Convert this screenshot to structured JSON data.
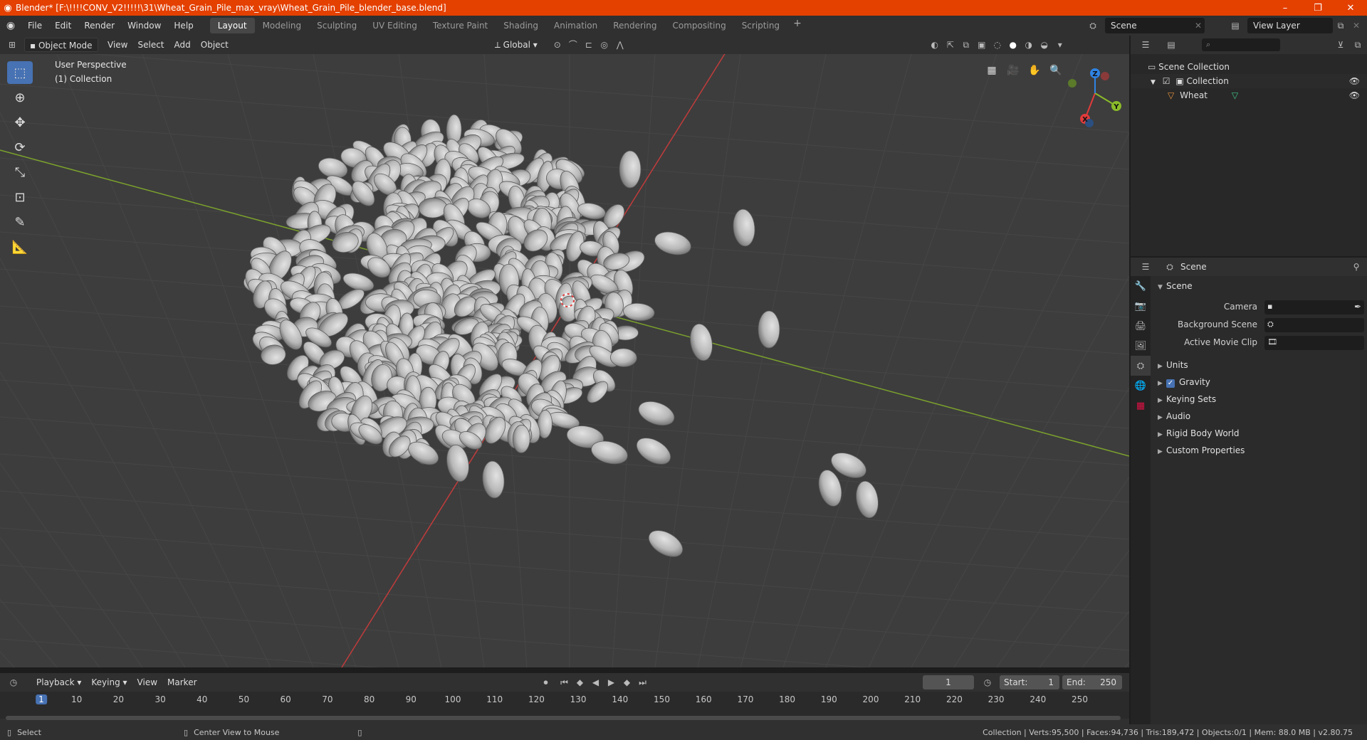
{
  "window": {
    "title": "Blender* [F:\\!!!!CONV_V2!!!!!\\31\\Wheat_Grain_Pile_max_vray\\Wheat_Grain_Pile_blender_base.blend]",
    "controls": [
      "–",
      "❐",
      "✕"
    ]
  },
  "menu": [
    "File",
    "Edit",
    "Render",
    "Window",
    "Help"
  ],
  "workspaces": [
    "Layout",
    "Modeling",
    "Sculpting",
    "UV Editing",
    "Texture Paint",
    "Shading",
    "Animation",
    "Rendering",
    "Compositing",
    "Scripting"
  ],
  "workspace_active": "Layout",
  "scene_name": "Scene",
  "view_layer_name": "View Layer",
  "viewport_header": {
    "mode": "Object Mode",
    "menus": [
      "View",
      "Select",
      "Add",
      "Object"
    ],
    "orientation": "Global"
  },
  "viewport": {
    "perspective": "User Perspective",
    "collection": "(1) Collection",
    "axis_colors": {
      "x": "#e23b3b",
      "y": "#8bbb29",
      "z": "#2f83e3"
    },
    "gizmo_labels": [
      "X",
      "Y",
      "Z"
    ]
  },
  "outliner": {
    "rows": [
      {
        "label": "Scene Collection"
      },
      {
        "label": "Collection"
      },
      {
        "label": "Wheat"
      }
    ]
  },
  "properties": {
    "header": "Scene",
    "panel_title": "Scene",
    "fields": [
      {
        "label": "Camera"
      },
      {
        "label": "Background Scene"
      },
      {
        "label": "Active Movie Clip"
      }
    ],
    "subpanels": [
      "Units",
      "Gravity",
      "Keying Sets",
      "Audio",
      "Rigid Body World",
      "Custom Properties"
    ],
    "gravity_checked": true
  },
  "timeline": {
    "menus": [
      "Playback",
      "Keying",
      "View",
      "Marker"
    ],
    "current_frame": "1",
    "start_label": "Start:",
    "start": "1",
    "end_label": "End:",
    "end": "250",
    "ruler": [
      "1",
      "10",
      "20",
      "30",
      "40",
      "50",
      "60",
      "70",
      "80",
      "90",
      "100",
      "110",
      "120",
      "130",
      "140",
      "150",
      "160",
      "170",
      "180",
      "190",
      "200",
      "210",
      "220",
      "230",
      "240",
      "250"
    ]
  },
  "statusbar": {
    "left1": "Select",
    "left2": "Center View to Mouse",
    "right": "Collection | Verts:95,500 | Faces:94,736 | Tris:189,472 | Objects:0/1 | Mem: 88.0 MB | v2.80.75"
  }
}
